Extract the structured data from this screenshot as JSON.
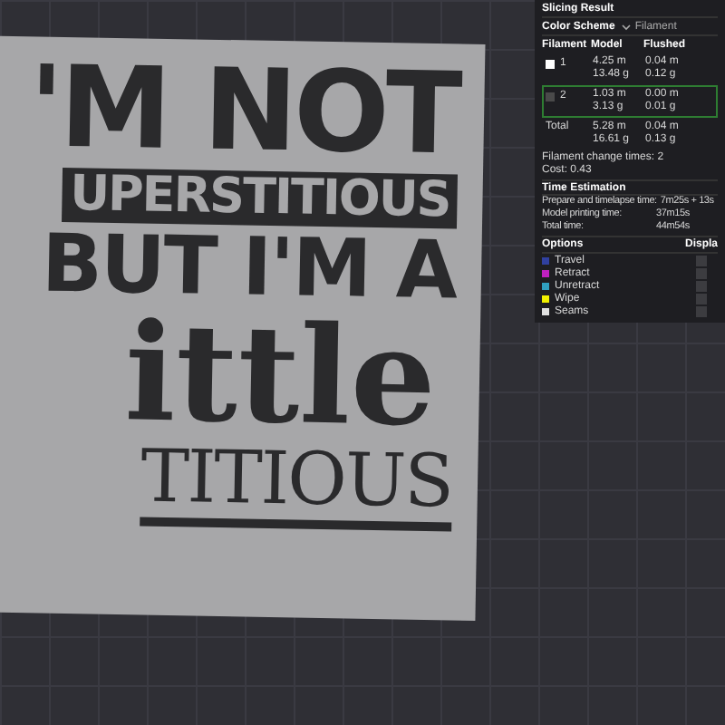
{
  "model_text": [
    "'M NOT",
    "UPERSTITIOUS",
    "BUT I'M A",
    "ittle",
    "TITIOUS"
  ],
  "slicing_result": {
    "title": "Slicing Result",
    "color_scheme_label": "Color Scheme",
    "color_scheme_value": "Filament",
    "columns": [
      "Filament",
      "Model",
      "Flushed"
    ],
    "filaments": [
      {
        "number": "1",
        "color": "#ffffff",
        "selected": false,
        "model": [
          "4.25 m",
          "13.48 g"
        ],
        "flushed": [
          "0.04 m",
          "0.12 g"
        ]
      },
      {
        "number": "2",
        "color": "#4a4a4a",
        "selected": true,
        "model": [
          "1.03 m",
          "3.13 g"
        ],
        "flushed": [
          "0.00 m",
          "0.01 g"
        ]
      }
    ],
    "total": {
      "label": "Total",
      "model": [
        "5.28 m",
        "16.61 g"
      ],
      "flushed": [
        "0.04 m",
        "0.13 g"
      ]
    },
    "change_times": "Filament change times:  2",
    "cost": "Cost:  0.43"
  },
  "time_estimation": {
    "title": "Time Estimation",
    "rows": [
      {
        "label": "Prepare and timelapse time:",
        "value": "7m25s + 13s"
      },
      {
        "label": "Model printing time:",
        "value": "37m15s"
      },
      {
        "label": "Total time:",
        "value": "44m54s"
      }
    ]
  },
  "options": {
    "columns": [
      "Options",
      "Displa"
    ],
    "items": [
      {
        "label": "Travel",
        "color": "#3040a0",
        "checked": false
      },
      {
        "label": "Retract",
        "color": "#c020c0",
        "checked": false
      },
      {
        "label": "Unretract",
        "color": "#30a0c0",
        "checked": false
      },
      {
        "label": "Wipe",
        "color": "#f0f000",
        "checked": false
      },
      {
        "label": "Seams",
        "color": "#e0e0e0",
        "checked": false
      }
    ]
  }
}
